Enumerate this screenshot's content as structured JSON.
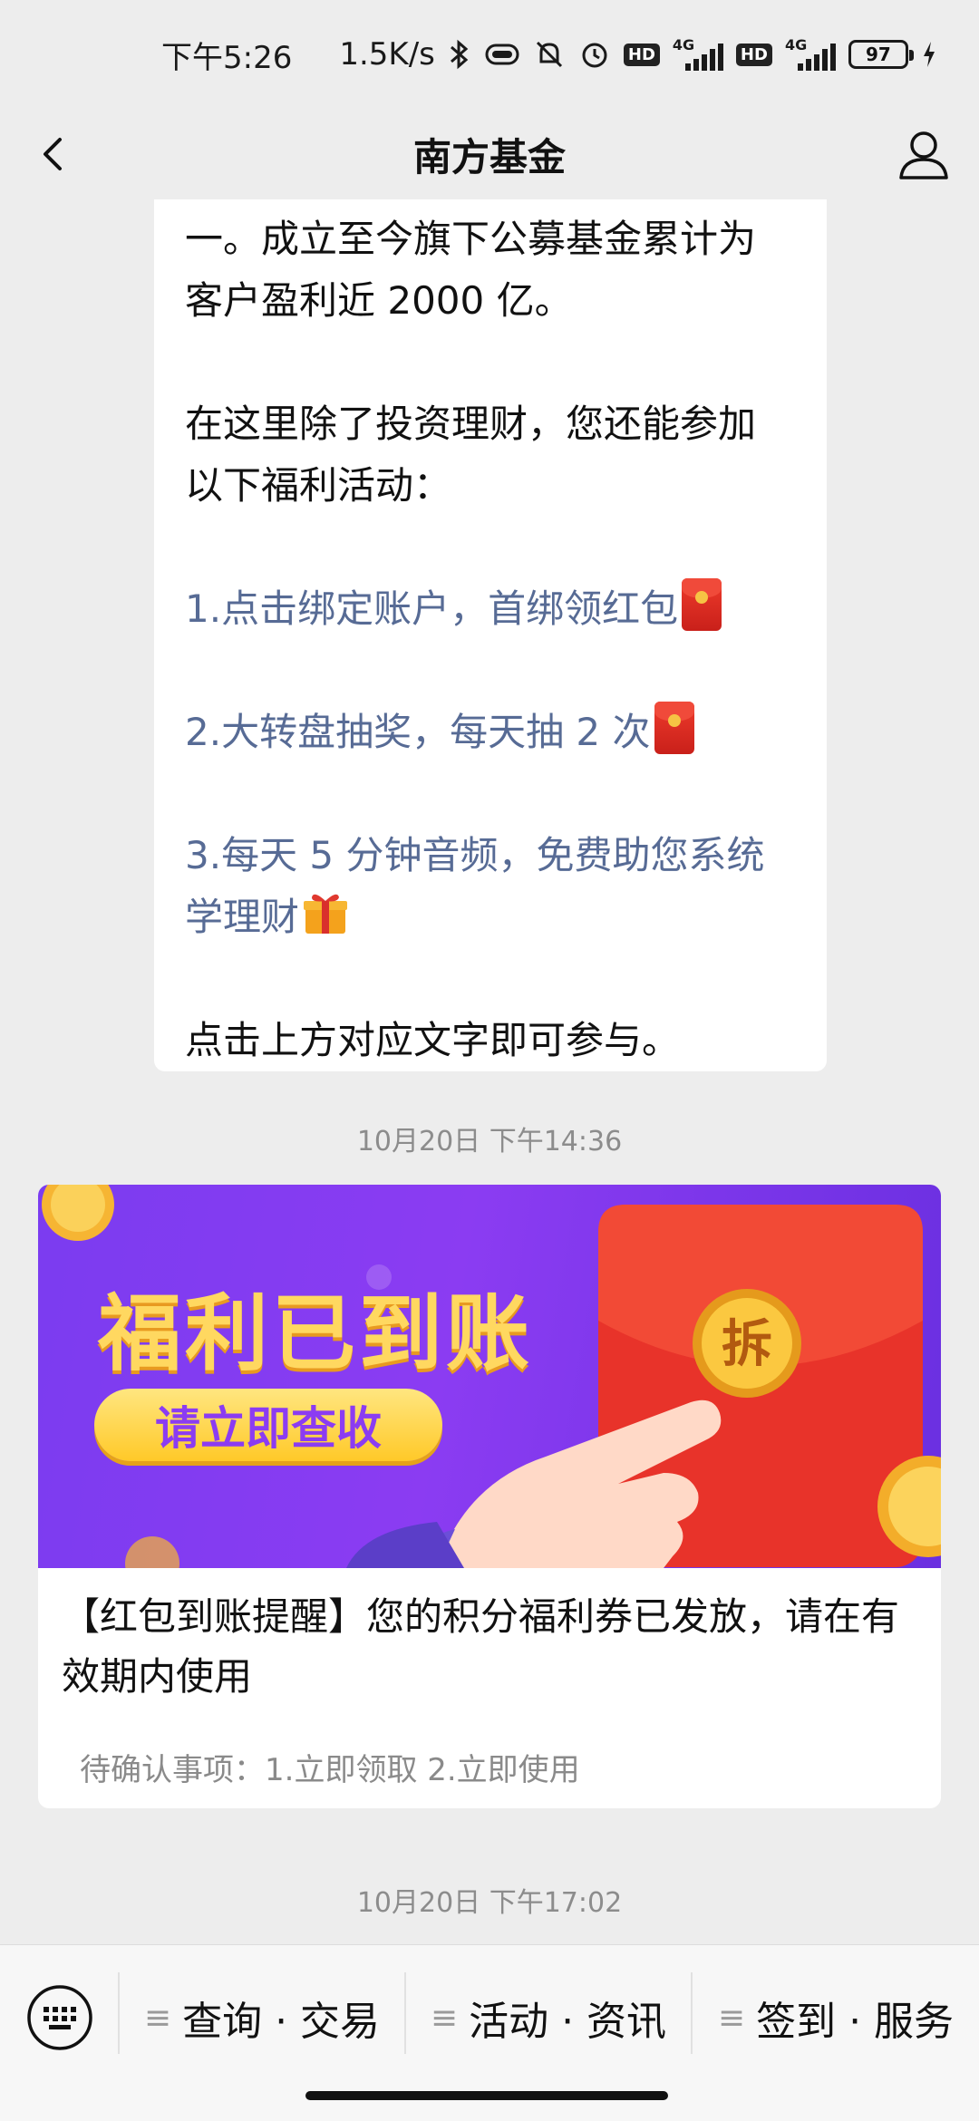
{
  "status_bar": {
    "time": "下午5:26",
    "speed": "1.5K/s",
    "hd_badge_1": "HD",
    "network_1": "4G",
    "hd_badge_2": "HD",
    "network_2": "4G",
    "battery": "97",
    "battery_level": 0.97
  },
  "nav": {
    "title": "南方基金",
    "back_icon": "chevron-left-icon",
    "profile_icon": "person-icon"
  },
  "message": {
    "para1_line1": "一。成立至今旗下公募基金累计为",
    "para1_line2": "客户盈利近 2000 亿。",
    "para2_line1": "在这里除了投资理财，您还能参加",
    "para2_line2": "以下福利活动：",
    "link1": "1.点击绑定账户，首绑领红包",
    "link2": "2.大转盘抽奖，每天抽 2 次",
    "link3_line1": "3.每天 5 分钟音频，免费助您系统",
    "link3_line2": "学理财",
    "footer": "点击上方对应文字即可参与。"
  },
  "timestamp1": "10月20日 下午14:36",
  "article": {
    "banner_title": "福利已到账",
    "banner_button": "请立即查收",
    "banner_stamp": "拆",
    "title": "【红包到账提醒】您的积分福利券已发放，请在有效期内使用",
    "subtitle": "待确认事项：1.立即领取  2.立即使用"
  },
  "timestamp2": "10月20日 下午17:02",
  "menu": {
    "keyboard_icon": "keyboard-icon",
    "items": [
      {
        "label": "查询 · 交易"
      },
      {
        "label": "活动 · 资讯"
      },
      {
        "label": "签到 · 服务"
      }
    ]
  },
  "colors": {
    "link": "#576b95",
    "banner_purple": "#8b3cf2",
    "banner_gold": "#ffd860",
    "red_packet": "#e8332a"
  }
}
